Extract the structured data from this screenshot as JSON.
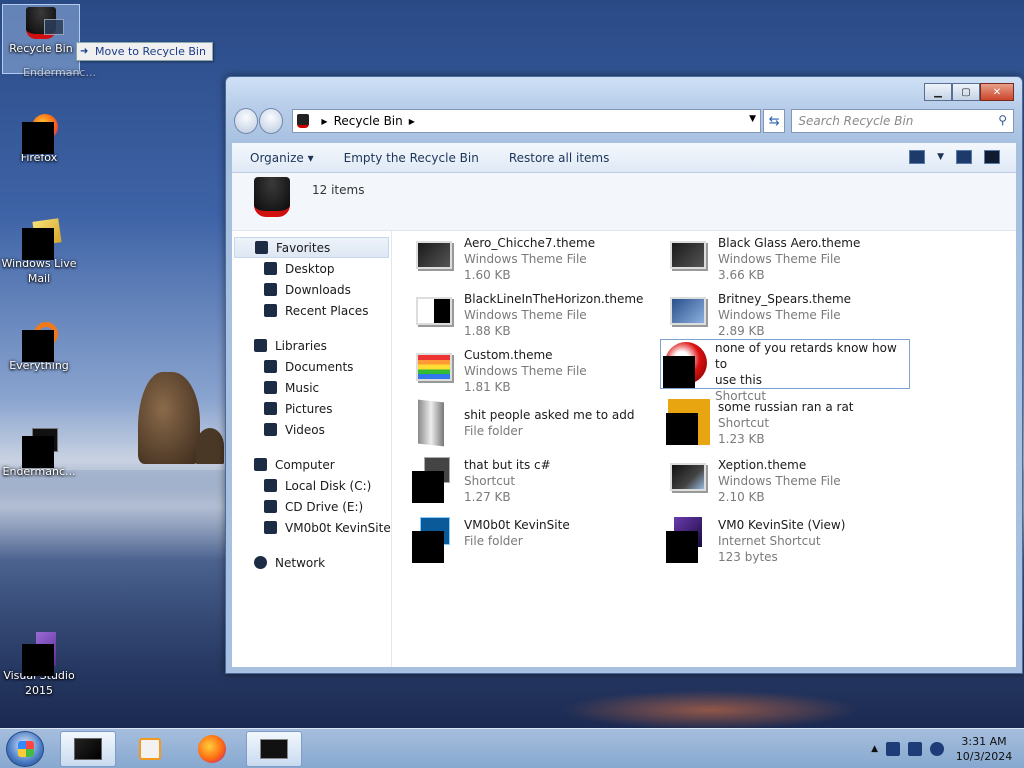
{
  "desktop": {
    "icons": [
      {
        "label": "Recycle Bin",
        "sublabel": "Endermanc...",
        "icon": "recycle-bin-icon"
      },
      {
        "label": "Firefox",
        "icon": "firefox-icon"
      },
      {
        "label": "Windows Live Mail",
        "icon": "windows-live-mail-icon"
      },
      {
        "label": "Everything",
        "icon": "everything-icon"
      },
      {
        "label": "Endermanc...",
        "icon": "endermanch-icon"
      },
      {
        "label": "Visual Studio 2015",
        "icon": "visual-studio-icon"
      }
    ],
    "drag_tooltip": "Move to Recycle Bin"
  },
  "window": {
    "address": {
      "location": "Recycle Bin",
      "search_placeholder": "Search Recycle Bin"
    },
    "toolbar": {
      "organize": "Organize",
      "empty": "Empty the Recycle Bin",
      "restore": "Restore all items"
    },
    "header": {
      "count": "12 items"
    },
    "nav": {
      "favorites": {
        "label": "Favorites",
        "items": [
          "Desktop",
          "Downloads",
          "Recent Places"
        ]
      },
      "libraries": {
        "label": "Libraries",
        "items": [
          "Documents",
          "Music",
          "Pictures",
          "Videos"
        ]
      },
      "computer": {
        "label": "Computer",
        "items": [
          "Local Disk (C:)",
          "CD Drive (E:)",
          "VM0b0t KevinSite"
        ]
      },
      "network": {
        "label": "Network"
      }
    },
    "files": [
      {
        "name": "Aero_Chicche7.theme",
        "type": "Windows Theme File",
        "size": "1.60 KB"
      },
      {
        "name": "Black Glass Aero.theme",
        "type": "Windows Theme File",
        "size": "3.66 KB"
      },
      {
        "name": "BlackLineInTheHorizon.theme",
        "type": "Windows Theme File",
        "size": "1.88 KB"
      },
      {
        "name": "Britney_Spears.theme",
        "type": "Windows Theme File",
        "size": "2.89 KB"
      },
      {
        "name": "Custom.theme",
        "type": "Windows Theme File",
        "size": "1.81 KB"
      },
      {
        "name": "none of you retards know how to",
        "name2": "use this",
        "type": "Shortcut",
        "size": ""
      },
      {
        "name": "shit people asked me to add",
        "type": "File folder",
        "size": ""
      },
      {
        "name": "some russian ran a rat",
        "type": "Shortcut",
        "size": "1.23 KB"
      },
      {
        "name": "that but its c#",
        "type": "Shortcut",
        "size": "1.27 KB"
      },
      {
        "name": "Xeption.theme",
        "type": "Windows Theme File",
        "size": "2.10 KB"
      },
      {
        "name": "VM0b0t KevinSite",
        "type": "File folder",
        "size": ""
      },
      {
        "name": "VM0 KevinSite (View)",
        "type": "Internet Shortcut",
        "size": "123 bytes"
      }
    ]
  },
  "taskbar": {
    "time": "3:31 AM",
    "date": "10/3/2024"
  }
}
